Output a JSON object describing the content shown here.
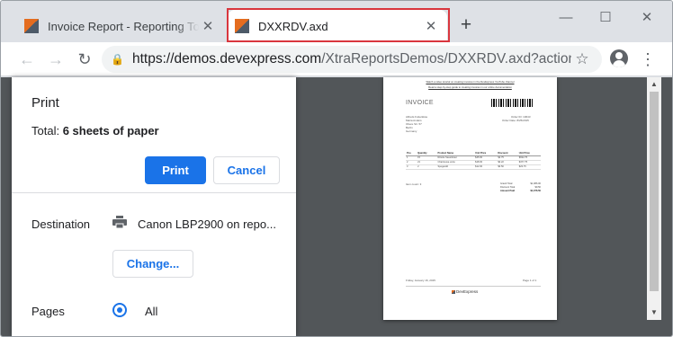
{
  "colors": {
    "accent": "#1a73e8",
    "highlight_border": "#d9363e",
    "viewer_bg": "#525659"
  },
  "tabs": [
    {
      "title": "Invoice Report - Reporting Tool for",
      "close": "✕",
      "favicon": "devexpress-icon"
    },
    {
      "title": "DXXRDV.axd",
      "close": "✕",
      "favicon": "devexpress-icon",
      "active": true
    }
  ],
  "new_tab": "+",
  "window_controls": {
    "minimize": "—",
    "maximize": "☐",
    "close": "✕"
  },
  "toolbar": {
    "back": "←",
    "forward": "→",
    "reload": "↻",
    "url_host": "https://demos.devexpress.com",
    "url_path": "/XtraReportsDemos/DXXRDV.axd?actionKey...",
    "lock": "🔒",
    "star": "☆",
    "menu": "⋮"
  },
  "print_panel": {
    "title": "Print",
    "total_prefix": "Total: ",
    "total_value": "6 sheets of paper",
    "print_label": "Print",
    "cancel_label": "Cancel",
    "destination_label": "Destination",
    "destination_value": "Canon LBP2900 on repo...",
    "change_label": "Change...",
    "pages_label": "Pages",
    "pages_value": "All"
  },
  "preview": {
    "link1": "Watch a video tutorial on creating invoices in the DevExpress YouTube channel",
    "link2": "Read a step-by-step guide to creating invoices in our online documentation",
    "title": "INVOICE",
    "customer": [
      "Alfreds Futterkiste",
      "Maria Anders",
      "Obere Str. 57",
      "Berlin",
      "Germany"
    ],
    "order_id": "Order ID: 10643",
    "order_date": "Order Date: 8/25/2015",
    "columns": [
      "Pos",
      "Quantity",
      "Product Name",
      "Unit Price",
      "Discount",
      "Unit Price"
    ],
    "rows": [
      [
        "1",
        "15",
        "Rössle Sauerkraut",
        "$45.60",
        "$2.75",
        "$632.75"
      ],
      [
        "2",
        "21",
        "Chartreuse verte",
        "$18.00",
        "$0.22",
        "$377.75"
      ],
      [
        "3",
        "2",
        "Spegesild",
        "$12.00",
        "$0.50",
        "$23.75"
      ]
    ],
    "item_count": "Item count: 3",
    "totals": [
      [
        "Grand Total",
        "$1,086.00"
      ],
      [
        "Discount Total",
        "$9.50"
      ],
      [
        "Amount Paid",
        "$1,076.50"
      ]
    ],
    "footer_date": "Friday, January 16, 2015",
    "footer_page": "Page 1 of 1",
    "logo_text": "DevExpress"
  },
  "scrollbar": {
    "up": "▲",
    "down": "▼"
  }
}
